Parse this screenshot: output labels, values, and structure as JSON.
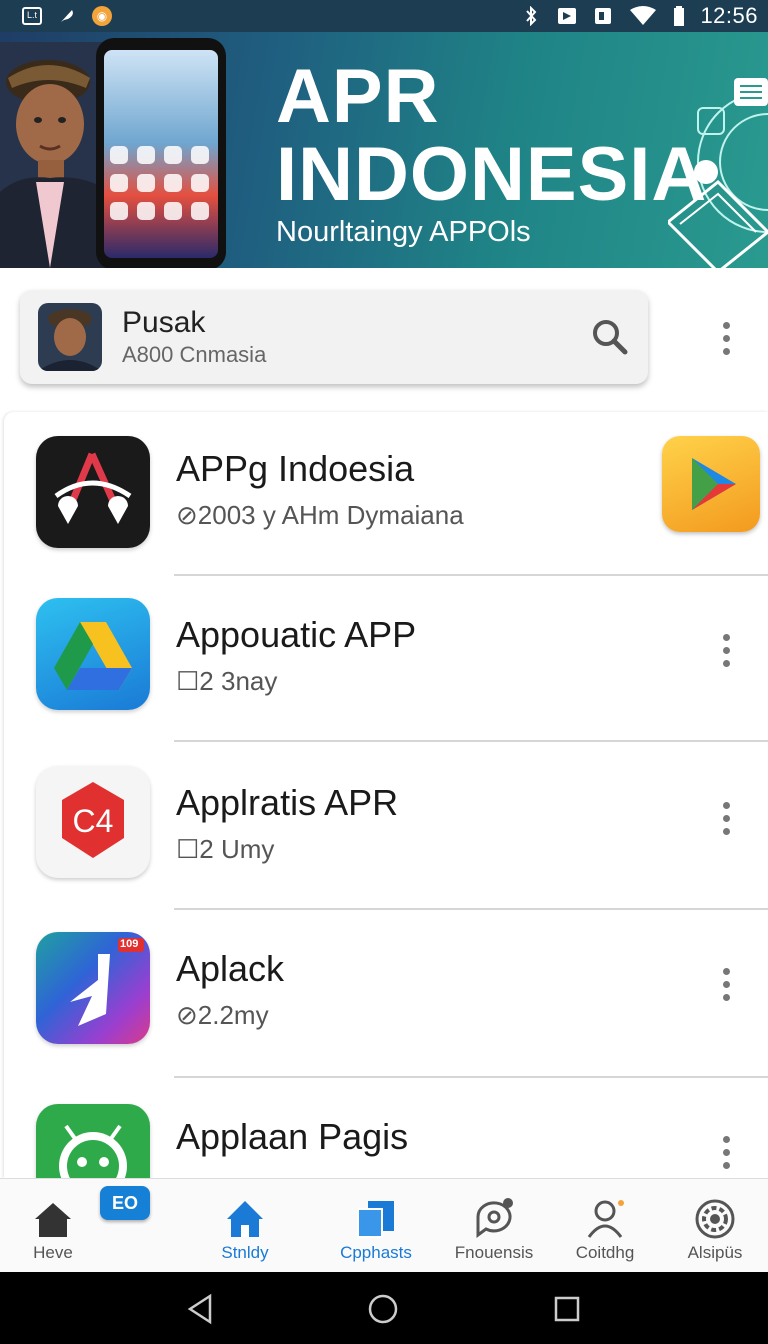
{
  "status_bar": {
    "time": "12:56",
    "left_icons": [
      "notification-box-icon",
      "feather-icon",
      "coin-icon"
    ],
    "right_icons": [
      "bluetooth-icon",
      "nfc-icon",
      "nfc-alt-icon",
      "wifi-icon",
      "battery-icon"
    ]
  },
  "banner": {
    "title_line1": "APR",
    "title_line2": "INDONESIA",
    "subtitle": "Nourltaingy APPOls"
  },
  "search_card": {
    "title": "Pusak",
    "subtitle": "A800 Cnmasia"
  },
  "apps": [
    {
      "name": "APPg Indoesia",
      "meta": "⊘2003 y AHm Dymaiana",
      "icon": "app-route-icon"
    },
    {
      "name": "Appouatic APP",
      "meta": "☐2 3nay",
      "icon": "drive-triangle-icon"
    },
    {
      "name": "Applratis APR",
      "meta": "☐2 Umy",
      "icon": "c4-hexagon-icon"
    },
    {
      "name": "Aplack",
      "meta": "⊘2.2my",
      "icon": "aplack-j-icon",
      "badge": "109"
    },
    {
      "name": "Applaan Pagis",
      "meta": "",
      "icon": "android-robot-icon"
    }
  ],
  "first_item_badge_icon": "play-store-icon",
  "bottom_nav": [
    {
      "label": "Heve",
      "icon": "home-icon",
      "active": false
    },
    {
      "label": "Stnldy",
      "icon": "home-blue-icon",
      "active": true
    },
    {
      "label": "Cpphasts",
      "icon": "copy-apps-icon",
      "active": true
    },
    {
      "label": "Fnouensis",
      "icon": "chat-bubble-icon",
      "active": false
    },
    {
      "label": "Coitdhg",
      "icon": "profile-icon",
      "active": false
    },
    {
      "label": "Alsipüs",
      "icon": "settings-gear-icon",
      "active": false
    }
  ],
  "fab_badge": "EO",
  "colors": {
    "status_bar": "#1c3d52",
    "accent_blue": "#1a7ad6",
    "banner_start": "#1f3d66",
    "banner_end": "#2a9a8f"
  }
}
